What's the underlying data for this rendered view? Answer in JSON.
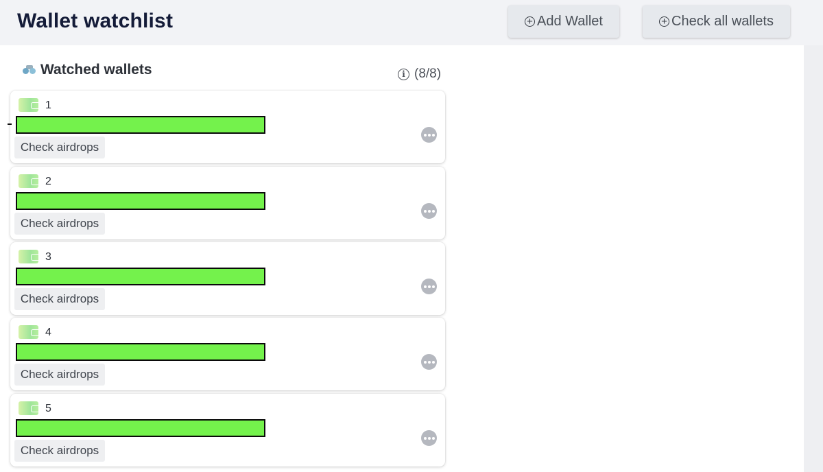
{
  "header": {
    "title": "Wallet watchlist",
    "add_wallet_label": "Add Wallet",
    "check_all_label": "Check all wallets"
  },
  "section": {
    "title": "Watched wallets",
    "count": "(8/8)"
  },
  "wallets": [
    {
      "number": "1",
      "action_label": "Check airdrops"
    },
    {
      "number": "2",
      "action_label": "Check airdrops"
    },
    {
      "number": "3",
      "action_label": "Check airdrops"
    },
    {
      "number": "4",
      "action_label": "Check airdrops"
    },
    {
      "number": "5",
      "action_label": "Check airdrops"
    }
  ],
  "icons": {
    "add": "plus-circle-icon",
    "section": "binoculars-icon",
    "info": "info-icon",
    "wallet": "wallet-icon",
    "more": "more-icon"
  },
  "colors": {
    "redaction": "#74f24c",
    "title": "#141b38"
  }
}
